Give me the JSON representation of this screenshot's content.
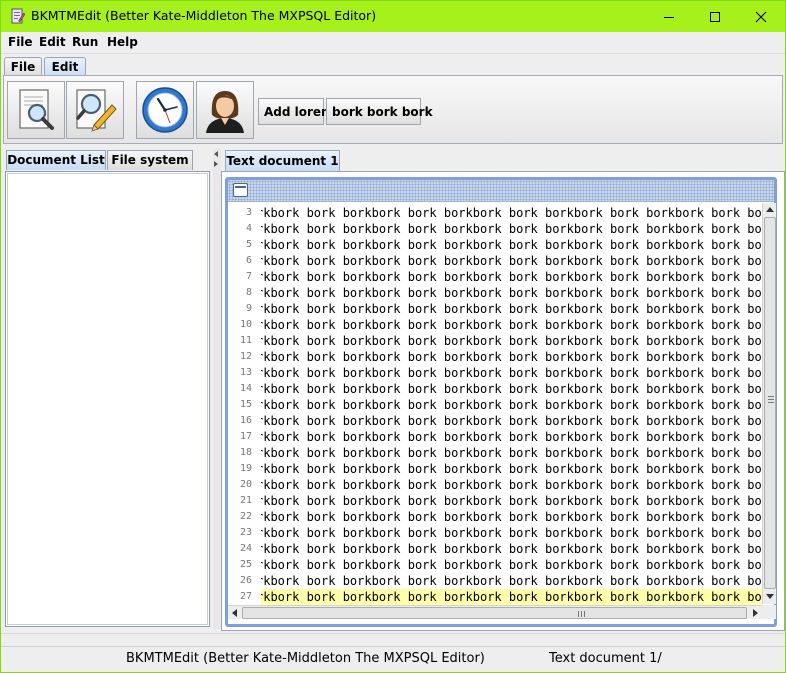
{
  "window": {
    "title": "BKMTMEdit (Better Kate-Middleton The MXPSQL Editor)",
    "accent": "#a6f01c"
  },
  "menubar": [
    "File",
    "Edit",
    "Run",
    "Help"
  ],
  "ribbon_tabs": [
    {
      "label": "File",
      "active": false
    },
    {
      "label": "Edit",
      "active": true
    }
  ],
  "toolbar": {
    "icons": [
      "preview-document-icon",
      "edit-document-icon",
      "clock-icon",
      "user-icon"
    ],
    "text_buttons": [
      "Add lorem",
      "bork bork bork"
    ]
  },
  "left_tabs": [
    {
      "label": "Document List",
      "active": true
    },
    {
      "label": "File system",
      "active": false
    }
  ],
  "document_tab": "Text document 1",
  "editor": {
    "line_numbers": [
      "3",
      "4",
      "5",
      "6",
      "7",
      "8",
      "9",
      "10",
      "11",
      "12",
      "13",
      "14",
      "15",
      "16",
      "17",
      "18",
      "19",
      "20",
      "21",
      "22",
      "23",
      "24",
      "25",
      "26",
      "27"
    ],
    "line_text": "rkbork bork borkbork bork borkbork bork borkbork bork borkbork bork bork",
    "current_line": "27",
    "current_line_color": "#ffffaa"
  },
  "statusbar": {
    "app_name": "BKMTMEdit (Better Kate-Middleton The MXPSQL Editor)",
    "document": "Text document 1/"
  }
}
